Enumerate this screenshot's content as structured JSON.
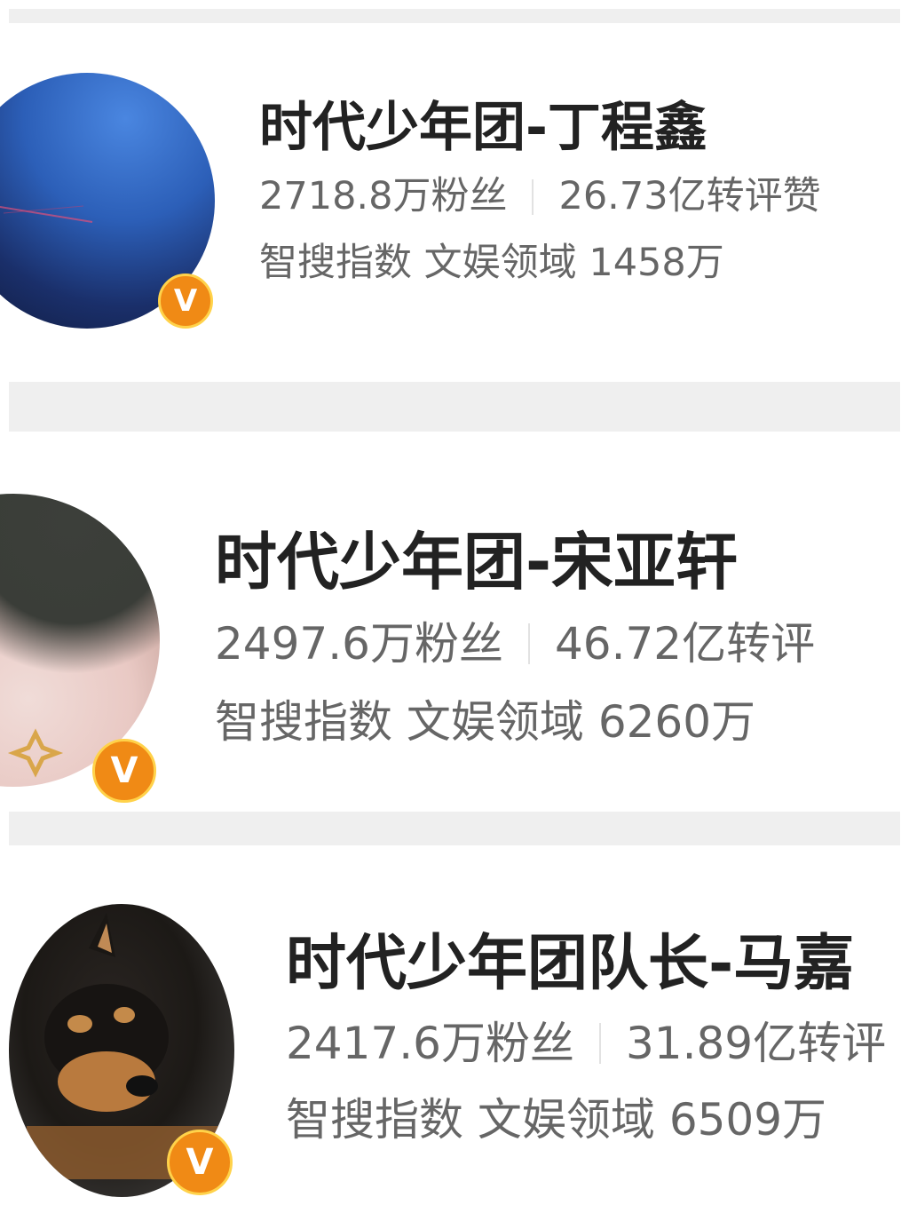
{
  "colors": {
    "badge": "#f08a15",
    "badge_ring": "#ffd24a",
    "separator": "#efefef"
  },
  "profiles": [
    {
      "name": "时代少年团-丁程鑫",
      "fans": "2718.8万粉丝",
      "interactions": "26.73亿转评赞",
      "index_label": "智搜指数",
      "domain": "文娱领域",
      "index_value": "1458万",
      "badge_icon": "verified-v-icon"
    },
    {
      "name": "时代少年团-宋亚轩",
      "fans": "2497.6万粉丝",
      "interactions": "46.72亿转评",
      "index_label": "智搜指数",
      "domain": "文娱领域",
      "index_value": "6260万",
      "badge_icon": "verified-v-icon"
    },
    {
      "name": "时代少年团队长-马嘉",
      "fans": "2417.6万粉丝",
      "interactions": "31.89亿转评",
      "index_label": "智搜指数",
      "domain": "文娱领域",
      "index_value": "6509万",
      "badge_icon": "verified-v-icon"
    }
  ]
}
